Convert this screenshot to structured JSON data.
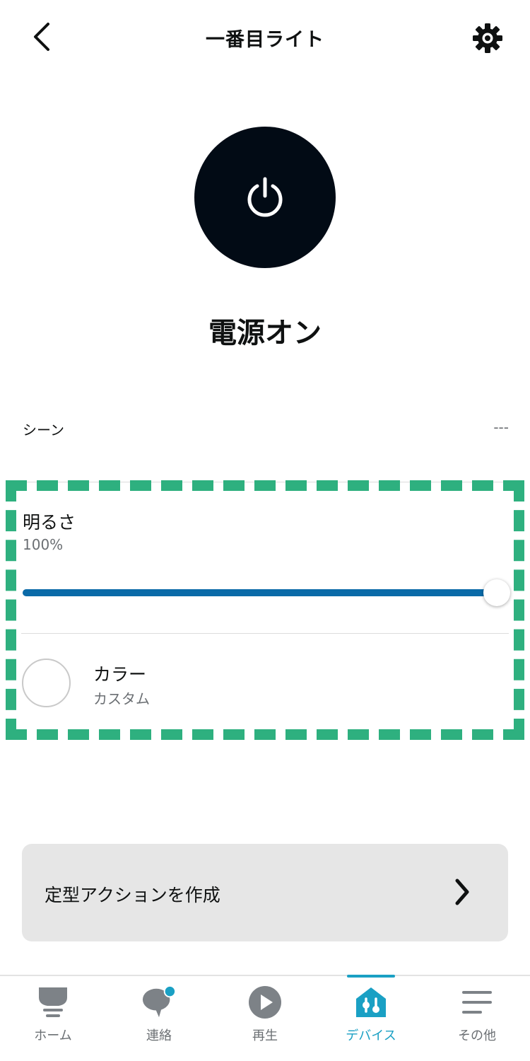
{
  "header": {
    "title": "一番目ライト",
    "back_icon": "chevron-left-icon",
    "settings_icon": "gear-icon"
  },
  "power": {
    "icon": "power-icon",
    "status": "電源オン",
    "color": "#020b15"
  },
  "scene": {
    "label": "シーン",
    "value": "---"
  },
  "brightness": {
    "label": "明るさ",
    "value_text": "100%",
    "level_percent": 100,
    "fill_color": "#0a6aa8"
  },
  "color": {
    "label": "カラー",
    "value": "カスタム",
    "swatch_color": "#ffffff"
  },
  "highlight_color": "#2eb07f",
  "routine": {
    "label": "定型アクションを作成",
    "icon": "chevron-right-icon"
  },
  "nav": {
    "active_color": "#1aa0c4",
    "items": [
      {
        "label": "ホーム",
        "icon": "home-icon",
        "active": false
      },
      {
        "label": "連絡",
        "icon": "chat-bubble-icon",
        "active": false,
        "badge": true
      },
      {
        "label": "再生",
        "icon": "play-icon",
        "active": false
      },
      {
        "label": "デバイス",
        "icon": "devices-icon",
        "active": true
      },
      {
        "label": "その他",
        "icon": "menu-icon",
        "active": false
      }
    ]
  }
}
